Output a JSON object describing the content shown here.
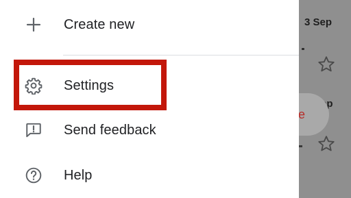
{
  "menu": {
    "create_new": "Create new",
    "settings": "Settings",
    "send_feedback": "Send feedback",
    "help": "Help"
  },
  "background": {
    "date_top": "3 Sep",
    "date_mid": "ep",
    "fab_letter": "e"
  },
  "highlight": {
    "target": "Settings",
    "color": "#c3170a"
  },
  "colors": {
    "text": "#202124",
    "icon": "#5f6368",
    "scrim": "#8f8f8f"
  }
}
